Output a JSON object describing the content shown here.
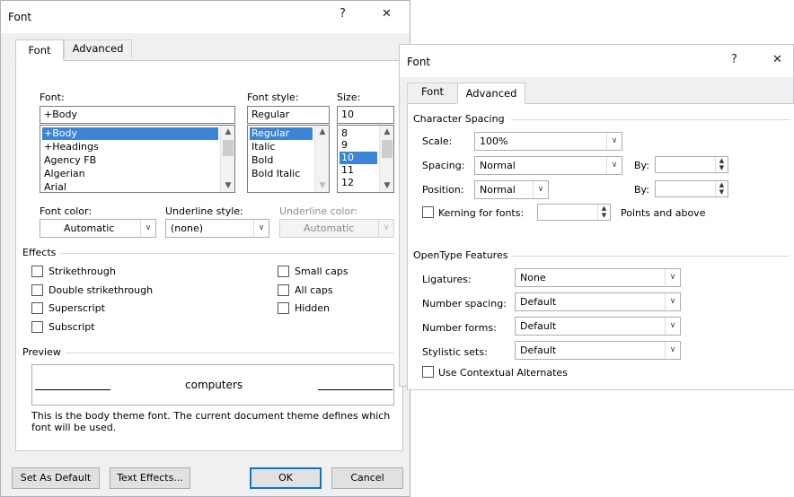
{
  "dialog1": {
    "title": "Font",
    "help": "?",
    "close": "✕",
    "tabs": [
      {
        "label": "Font"
      },
      {
        "label": "Advanced"
      }
    ],
    "font": {
      "label": "Font:",
      "value": "+Body",
      "list": [
        "+Body",
        "+Headings",
        "Agency FB",
        "Algerian",
        "Arial"
      ],
      "selected": 0
    },
    "style": {
      "label": "Font style:",
      "value": "Regular",
      "list": [
        "Regular",
        "Italic",
        "Bold",
        "Bold Italic"
      ],
      "selected": 0
    },
    "size": {
      "label": "Size:",
      "value": "10",
      "list": [
        "8",
        "9",
        "10",
        "11",
        "12"
      ],
      "selected": 2
    },
    "font_color": {
      "label": "Font color:",
      "value": "Automatic"
    },
    "underline_style": {
      "label": "Underline style:",
      "value": "(none)"
    },
    "underline_color": {
      "label": "Underline color:",
      "value": "Automatic"
    },
    "effects": {
      "label": "Effects",
      "items": [
        "Strikethrough",
        "Double strikethrough",
        "Superscript",
        "Subscript",
        "Small caps",
        "All caps",
        "Hidden"
      ]
    },
    "preview": {
      "label": "Preview",
      "text": "computers",
      "description": "This is the body theme font. The current document theme defines which font will be used."
    },
    "buttons": {
      "set_default": "Set As Default",
      "text_effects": "Text Effects...",
      "ok": "OK",
      "cancel": "Cancel"
    }
  },
  "dialog2": {
    "title": "Font",
    "help": "?",
    "close": "✕",
    "tabs": [
      {
        "label": "Font"
      },
      {
        "label": "Advanced"
      }
    ],
    "character_spacing": {
      "label": "Character Spacing",
      "scale_label": "Scale:",
      "scale_value": "100%",
      "spacing_label": "Spacing:",
      "spacing_value": "Normal",
      "position_label": "Position:",
      "position_value": "Normal",
      "by_label": "By:",
      "kerning_label": "Kerning for fonts:",
      "kerning_suffix": "Points and above"
    },
    "opentype": {
      "label": "OpenType Features",
      "ligatures_label": "Ligatures:",
      "ligatures_value": "None",
      "number_spacing_label": "Number spacing:",
      "number_spacing_value": "Default",
      "number_forms_label": "Number forms:",
      "number_forms_value": "Default",
      "stylistic_sets_label": "Stylistic sets:",
      "stylistic_sets_value": "Default",
      "contextual_label": "Use Contextual Alternates"
    }
  },
  "colors": {
    "selection": "#3c84d6",
    "dialog_bg": "#f0f0f0",
    "default_button_border": "#0078d7"
  }
}
